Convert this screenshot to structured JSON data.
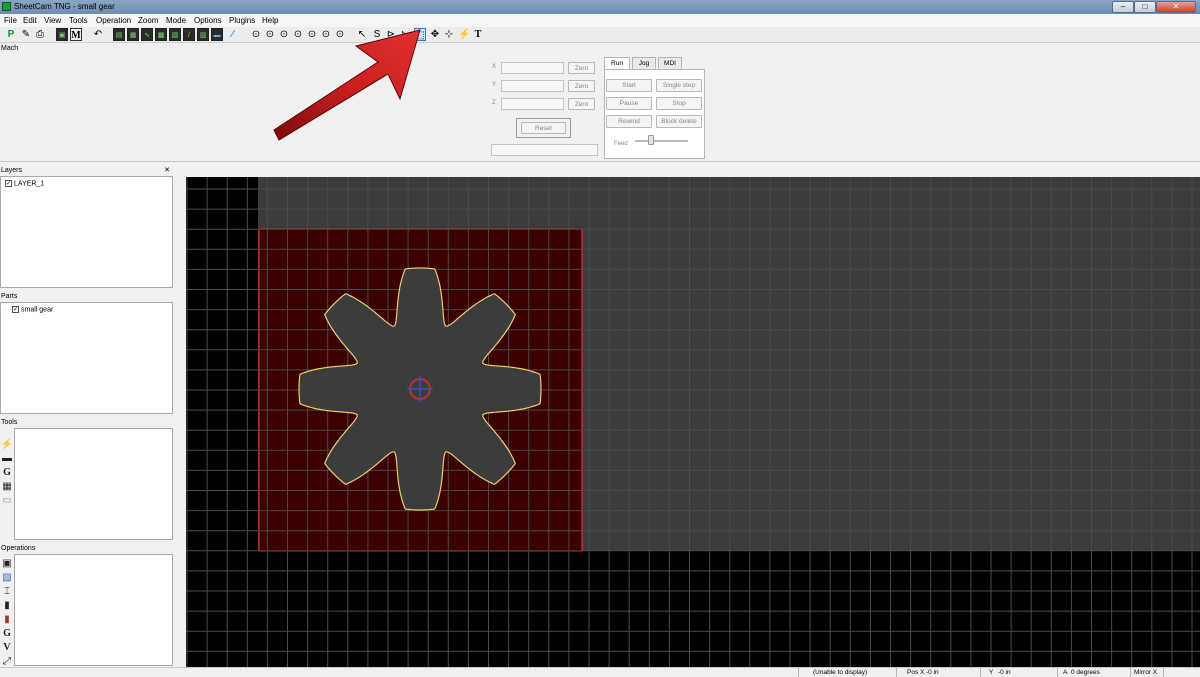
{
  "window": {
    "title": "SheetCam TNG - small gear",
    "min": "–",
    "max": "□",
    "close": "✕"
  },
  "menu": [
    "File",
    "Edit",
    "View",
    "Tools",
    "Operation",
    "Zoom",
    "Mode",
    "Options",
    "Plugins",
    "Help"
  ],
  "toolbar": {
    "icons": [
      "new-part-icon",
      "edit-icon",
      "print-icon",
      "machine-icon",
      "mach-icon",
      "undo-icon",
      "view-icons",
      "pointer-icon",
      "select-icon",
      "zoom-window-icon",
      "pan-icon",
      "move-icon",
      "rotate-icon",
      "text-icon"
    ],
    "p_label": "P",
    "m_label": "M",
    "t_label": "T"
  },
  "mach": {
    "title": "Mach",
    "axes": [
      {
        "label": "X",
        "zero": "Zero"
      },
      {
        "label": "Y",
        "zero": "Zero"
      },
      {
        "label": "Z",
        "zero": "Zero"
      }
    ],
    "reset": "Reset",
    "tabs": [
      "Run",
      "Jog",
      "MDI"
    ],
    "run_buttons": {
      "start": "Start",
      "single_step": "Single step",
      "pause": "Pause",
      "stop": "Stop",
      "rewind": "Rewind",
      "block_delete": "Block delete"
    },
    "feed_label": "Feed"
  },
  "panels": {
    "layers": {
      "title": "Layers",
      "close": "✕",
      "items": [
        "LAYER_1"
      ]
    },
    "parts": {
      "title": "Parts",
      "items": [
        "small gear"
      ]
    },
    "tools": {
      "title": "Tools"
    },
    "operations": {
      "title": "Operations"
    }
  },
  "status": {
    "message": "(Unable to display)",
    "pos_x_label": "Pos X",
    "pos_x": "-0 in",
    "y_label": "Y",
    "y": "-0 in",
    "a_label": "A",
    "a": "0 degrees",
    "mirror": "Mirror X"
  },
  "colors": {
    "canvas_bg": "#000000",
    "sheet": "#3c3c3c",
    "part_fill": "#3d0000",
    "part_border": "#ff3030",
    "gear_fill": "#3c3c3c",
    "gear_outline": "#e8d06a",
    "grid": "#4a4a4a"
  },
  "gear": {
    "teeth": 8
  }
}
